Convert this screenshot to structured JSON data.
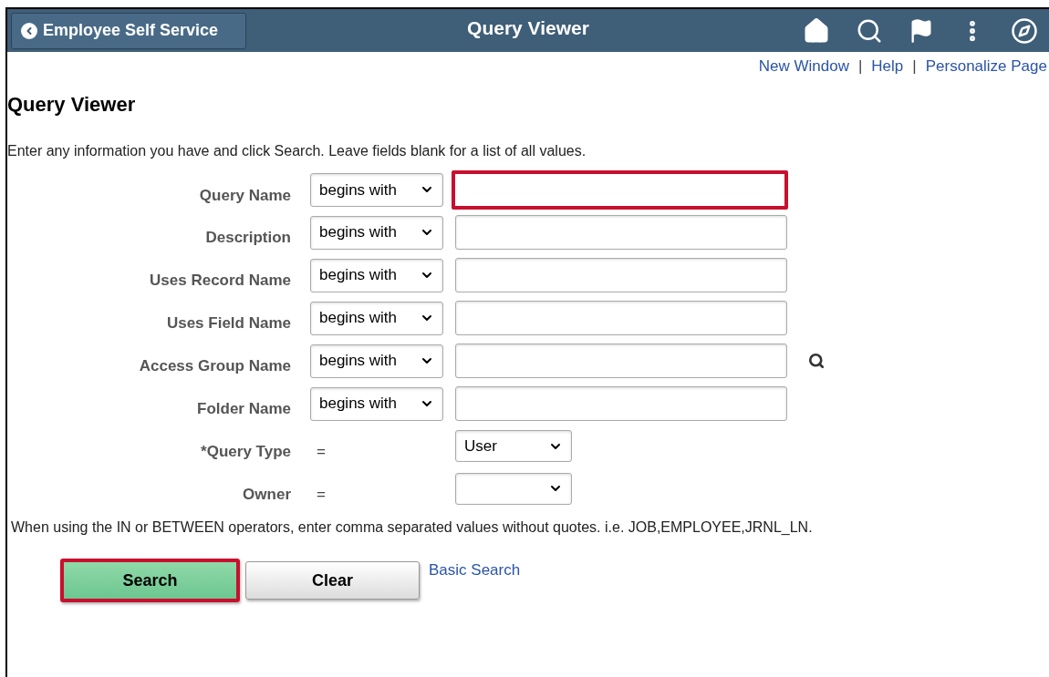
{
  "header": {
    "back_button": "Employee Self Service",
    "title": "Query Viewer"
  },
  "links": [
    {
      "label": "New Window",
      "separator": "|"
    },
    {
      "label": "Help",
      "separator": "|"
    },
    {
      "label": "Personalize Page"
    }
  ],
  "page_title": "Query Viewer",
  "instructions": "Enter any information you have and click Search. Leave fields blank for a list of all values.",
  "criteria": [
    {
      "kind": "text",
      "label": "Query Name",
      "operator": "begins with",
      "highlighted": true,
      "lookup": false
    },
    {
      "kind": "text",
      "label": "Description",
      "operator": "begins with",
      "highlighted": false,
      "lookup": false
    },
    {
      "kind": "text",
      "label": "Uses Record Name",
      "operator": "begins with",
      "highlighted": false,
      "lookup": false
    },
    {
      "kind": "text",
      "label": "Uses Field Name",
      "operator": "begins with",
      "highlighted": false,
      "lookup": false
    },
    {
      "kind": "text",
      "label": "Access Group Name",
      "operator": "begins with",
      "highlighted": false,
      "lookup": true
    },
    {
      "kind": "text",
      "label": "Folder Name",
      "operator": "begins with",
      "highlighted": false,
      "lookup": false
    },
    {
      "kind": "select",
      "label": "*Query Type",
      "operator": "=",
      "value": "User"
    },
    {
      "kind": "select",
      "label": "Owner",
      "operator": "="
    }
  ],
  "note": "When using the IN or BETWEEN operators, enter comma separated values without quotes. i.e. JOB,EMPLOYEE,JRNL_LN.",
  "buttons": [
    {
      "label": "Search",
      "kind": "primary",
      "highlighted": true
    },
    {
      "label": "Clear",
      "kind": "secondary",
      "highlighted": false
    }
  ],
  "basic_search_link": "Basic Search"
}
